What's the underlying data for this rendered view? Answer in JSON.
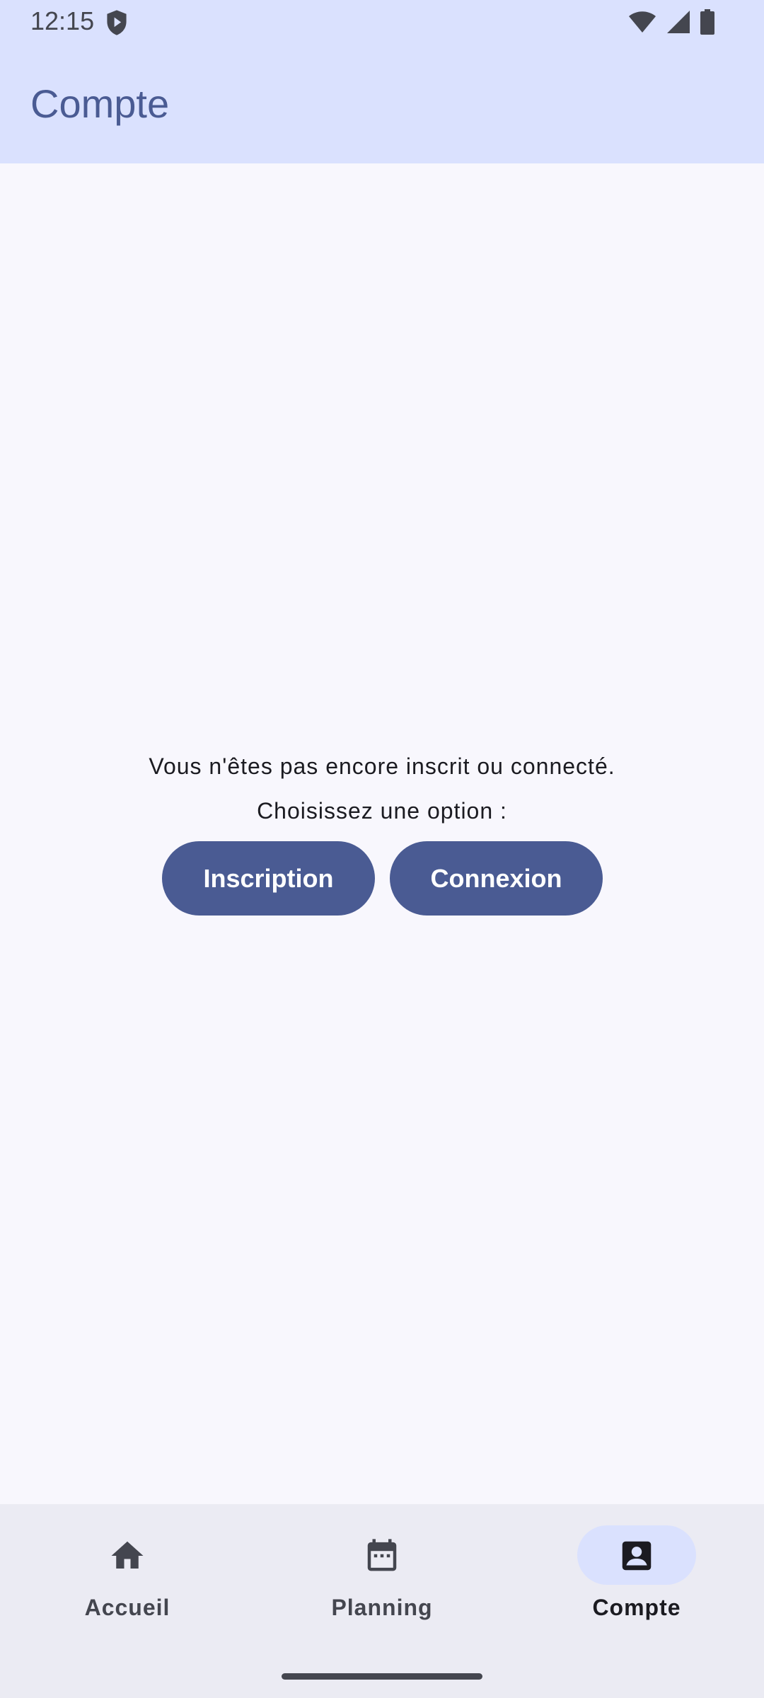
{
  "status_bar": {
    "time": "12:15",
    "icons": [
      "shield-icon",
      "wifi-icon",
      "signal-icon",
      "battery-icon"
    ]
  },
  "header": {
    "title": "Compte"
  },
  "main": {
    "message_line1": "Vous n'êtes pas encore inscrit ou connecté.",
    "message_line2": "Choisissez une option :",
    "buttons": [
      {
        "label": "Inscription"
      },
      {
        "label": "Connexion"
      }
    ]
  },
  "bottom_nav": {
    "items": [
      {
        "label": "Accueil",
        "icon": "home-icon",
        "active": false
      },
      {
        "label": "Planning",
        "icon": "calendar-icon",
        "active": false
      },
      {
        "label": "Compte",
        "icon": "account-box-icon",
        "active": true
      }
    ]
  },
  "colors": {
    "primary": "#4a5b93",
    "appbar_bg": "#dae1fe",
    "background": "#f8f7fd",
    "navbar_bg": "#ebebf3"
  }
}
